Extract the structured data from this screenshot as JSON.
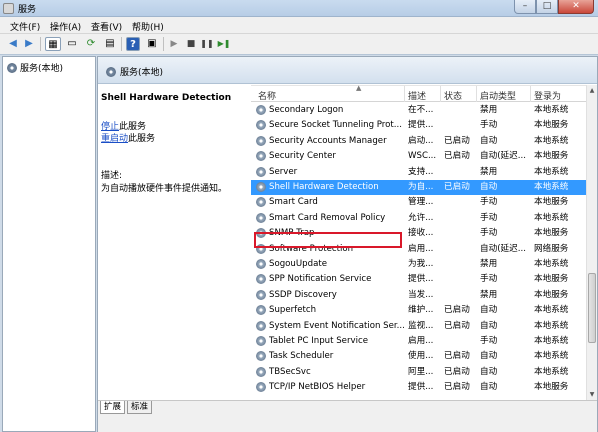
{
  "window": {
    "title": "服务"
  },
  "menu": [
    "文件(F)",
    "操作(A)",
    "查看(V)",
    "帮助(H)"
  ],
  "toolbar": {
    "icons": [
      "back-arrow-icon",
      "forward-arrow-icon",
      "console-tree-icon",
      "properties-icon",
      "refresh-icon",
      "export-icon",
      "help-icon",
      "panel-icon",
      "play-icon",
      "stop-icon",
      "pause-icon",
      "restart-icon"
    ],
    "symbols": [
      "◀",
      "▶",
      "▦",
      "▭",
      "⟳",
      "▤",
      "?",
      "▣",
      "▶",
      "■",
      "❚❚",
      "▶❚"
    ]
  },
  "tree": {
    "root": "服务(本地)"
  },
  "content_header": "服务(本地)",
  "detail": {
    "service_name": "Shell Hardware Detection",
    "stop_link": "停止",
    "stop_suffix": "此服务",
    "restart_link": "重启动",
    "restart_suffix": "此服务",
    "desc_label": "描述:",
    "desc_text": "为自动播放硬件事件提供通知。"
  },
  "columns": {
    "name": "名称",
    "desc": "描述",
    "status": "状态",
    "startup": "启动类型",
    "logon": "登录为"
  },
  "services": [
    {
      "name": "Secondary Logon",
      "desc": "在不...",
      "status": "",
      "startup": "禁用",
      "logon": "本地系统"
    },
    {
      "name": "Secure Socket Tunneling Prot...",
      "desc": "提供...",
      "status": "",
      "startup": "手动",
      "logon": "本地服务"
    },
    {
      "name": "Security Accounts Manager",
      "desc": "启动...",
      "status": "已启动",
      "startup": "自动",
      "logon": "本地系统"
    },
    {
      "name": "Security Center",
      "desc": "WSC...",
      "status": "已启动",
      "startup": "自动(延迟...",
      "logon": "本地服务"
    },
    {
      "name": "Server",
      "desc": "支持...",
      "status": "",
      "startup": "禁用",
      "logon": "本地系统"
    },
    {
      "name": "Shell Hardware Detection",
      "desc": "为自...",
      "status": "已启动",
      "startup": "自动",
      "logon": "本地系统"
    },
    {
      "name": "Smart Card",
      "desc": "管理...",
      "status": "",
      "startup": "手动",
      "logon": "本地服务"
    },
    {
      "name": "Smart Card Removal Policy",
      "desc": "允许...",
      "status": "",
      "startup": "手动",
      "logon": "本地系统"
    },
    {
      "name": "SNMP Trap",
      "desc": "接收...",
      "status": "",
      "startup": "手动",
      "logon": "本地服务"
    },
    {
      "name": "Software Protection",
      "desc": "启用...",
      "status": "",
      "startup": "自动(延迟...",
      "logon": "网络服务"
    },
    {
      "name": "SogouUpdate",
      "desc": "为我...",
      "status": "",
      "startup": "禁用",
      "logon": "本地系统"
    },
    {
      "name": "SPP Notification Service",
      "desc": "提供...",
      "status": "",
      "startup": "手动",
      "logon": "本地服务"
    },
    {
      "name": "SSDP Discovery",
      "desc": "当发...",
      "status": "",
      "startup": "禁用",
      "logon": "本地服务"
    },
    {
      "name": "Superfetch",
      "desc": "维护...",
      "status": "已启动",
      "startup": "自动",
      "logon": "本地系统"
    },
    {
      "name": "System Event Notification Ser...",
      "desc": "监视...",
      "status": "已启动",
      "startup": "自动",
      "logon": "本地系统"
    },
    {
      "name": "Tablet PC Input Service",
      "desc": "启用...",
      "status": "",
      "startup": "手动",
      "logon": "本地系统"
    },
    {
      "name": "Task Scheduler",
      "desc": "使用...",
      "status": "已启动",
      "startup": "自动",
      "logon": "本地系统"
    },
    {
      "name": "TBSecSvc",
      "desc": "阿里...",
      "status": "已启动",
      "startup": "自动",
      "logon": "本地系统"
    },
    {
      "name": "TCP/IP NetBIOS Helper",
      "desc": "提供...",
      "status": "已启动",
      "startup": "自动",
      "logon": "本地服务"
    }
  ],
  "selected_index": 5,
  "tabs": [
    "扩展",
    "标准"
  ],
  "colors": {
    "selection": "#3399ff",
    "highlight_box": "#d9182a",
    "link": "#1a4ec6"
  }
}
